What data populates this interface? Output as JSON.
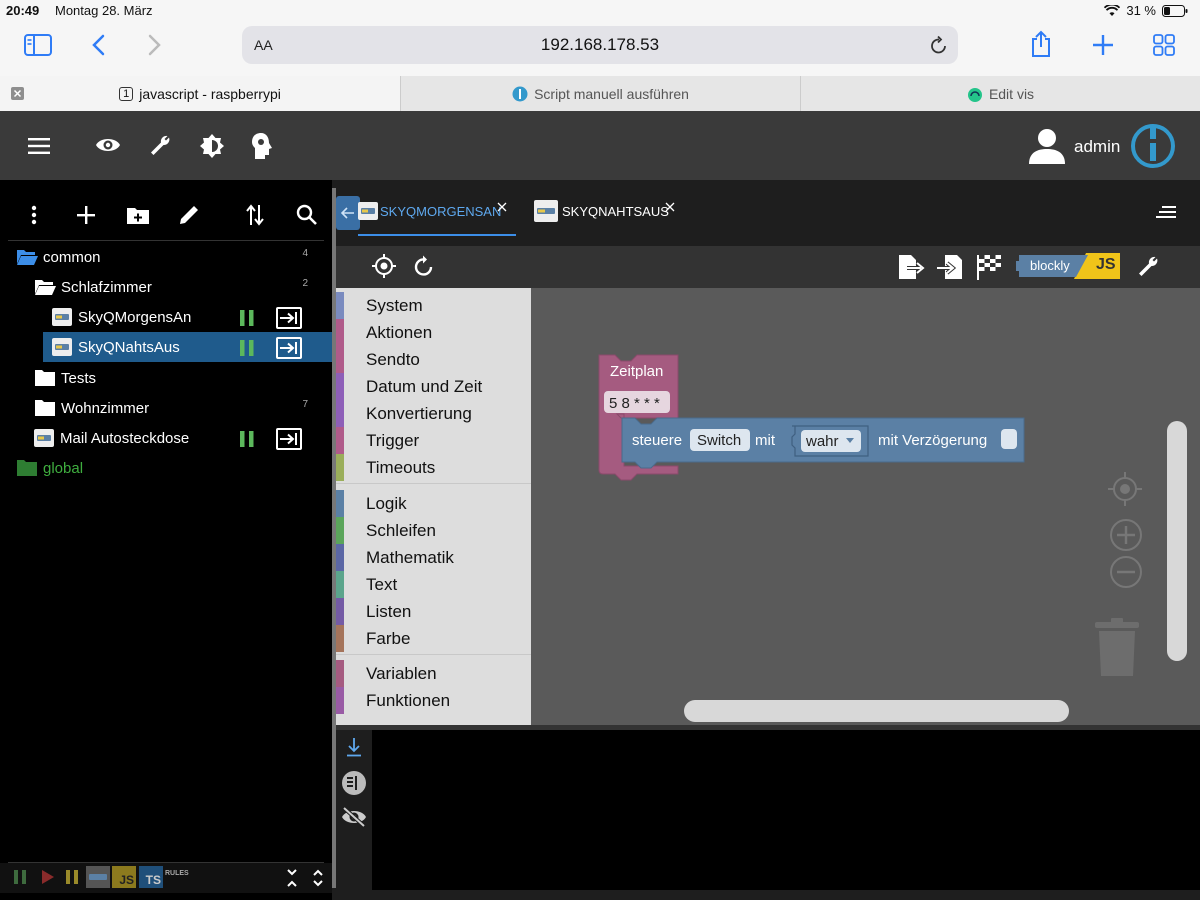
{
  "status": {
    "time": "20:49",
    "date": "Montag 28. März",
    "battery": "31 %"
  },
  "browser": {
    "text_size": "AA",
    "url": "192.168.178.53"
  },
  "tabs": [
    {
      "label": "javascript - raspberrypi",
      "badge": "1"
    },
    {
      "label": "Script manuell ausführen"
    },
    {
      "label": "Edit vis"
    }
  ],
  "header": {
    "user": "admin"
  },
  "tree": {
    "items": [
      {
        "label": "common",
        "count": "4"
      },
      {
        "label": "Schlafzimmer",
        "count": "2"
      },
      {
        "label": "SkyQMorgensAn"
      },
      {
        "label": "SkyQNahtsAus"
      },
      {
        "label": "Tests"
      },
      {
        "label": "Wohnzimmer",
        "count": "7"
      },
      {
        "label": "Mail Autosteckdose"
      },
      {
        "label": "global"
      }
    ]
  },
  "footer": {
    "js_label": "JS",
    "ts_label": "TS",
    "rules_label": "RULES"
  },
  "editor": {
    "tabs": [
      {
        "label": "SKYQMORGENSAN"
      },
      {
        "label": "SKYQNAHTSAUS"
      }
    ],
    "badge_blockly": "blockly",
    "badge_js": "JS"
  },
  "toolbox": {
    "categories": [
      {
        "label": "System",
        "color": "#7a8bbf"
      },
      {
        "label": "Aktionen",
        "color": "#b05b8a"
      },
      {
        "label": "Sendto",
        "color": "#b05b8a"
      },
      {
        "label": "Datum und Zeit",
        "color": "#8e5fb8"
      },
      {
        "label": "Konvertierung",
        "color": "#8e5fb8"
      },
      {
        "label": "Trigger",
        "color": "#b05b8a"
      },
      {
        "label": "Timeouts",
        "color": "#9aae5a"
      },
      {
        "label": "Logik",
        "color": "#5b80a5"
      },
      {
        "label": "Schleifen",
        "color": "#5ba55b"
      },
      {
        "label": "Mathematik",
        "color": "#5b67a5"
      },
      {
        "label": "Text",
        "color": "#5ba58c"
      },
      {
        "label": "Listen",
        "color": "#745ba5"
      },
      {
        "label": "Farbe",
        "color": "#a5745b"
      },
      {
        "label": "Variablen",
        "color": "#a55b80"
      },
      {
        "label": "Funktionen",
        "color": "#995ba5"
      }
    ]
  },
  "blocks": {
    "schedule_title": "Zeitplan",
    "schedule_value": "5 8 * * *",
    "control_label": "steuere",
    "control_target": "Switch",
    "control_with": "mit",
    "control_value": "wahr",
    "control_delay": "mit Verzögerung"
  }
}
